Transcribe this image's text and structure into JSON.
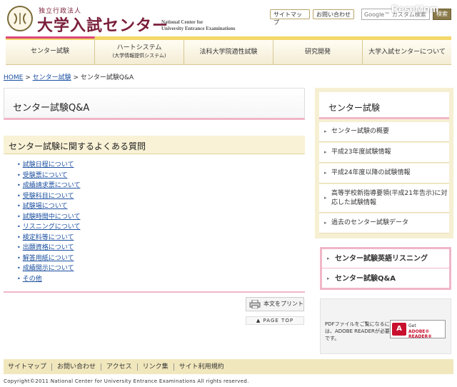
{
  "header": {
    "org_type": "独立行政法人",
    "site_name": "大学入試センター",
    "english_name_line1": "National Center for",
    "english_name_line2": "University Entrance Examinations",
    "util_links": [
      "サイトマップ",
      "お問い合わせ"
    ],
    "search_placeholder": "Google™ カスタム検索",
    "search_button": "検索",
    "watermark": "ReseMom"
  },
  "gnav": {
    "items": [
      {
        "label": "センター試験",
        "sub": ""
      },
      {
        "label": "ハートシステム",
        "sub": "(大学情報提供システム)"
      },
      {
        "label": "法科大学院適性試験",
        "sub": ""
      },
      {
        "label": "研究開発",
        "sub": ""
      },
      {
        "label": "大学入試センターについて",
        "sub": ""
      }
    ]
  },
  "breadcrumb": {
    "home": "HOME",
    "sep": ">",
    "parent": "センター試験",
    "current": "センター試験Q&A"
  },
  "main": {
    "page_title": "センター試験Q&A",
    "section_title": "センター試験に関するよくある質問",
    "qa_links": [
      "試験日程について",
      "受験票について",
      "成績請求票について",
      "受験科目について",
      "試験場について",
      "試験時間中について",
      "リスニングについて",
      "検定料等について",
      "出願資格について",
      "解答用紙について",
      "成績開示について",
      "その他"
    ],
    "print_button": "本文をプリント",
    "page_top": "▲ PAGE TOP"
  },
  "sidebar": {
    "title": "センター試験",
    "items": [
      "センター試験の概要",
      "平成23年度試験情報",
      "平成24年度以降の試験情報",
      "高等学校新指導要領(平成21年告示)に対応した試験情報",
      "過去のセンター試験データ"
    ],
    "featured_links": [
      "センター試験英語リスニング",
      "センター試験Q&A"
    ],
    "pdf_note": "PDFファイルをご覧になるには、ADOBE READERが必要です。",
    "reader_get": "Get",
    "reader_label": "ADOBE® READER®"
  },
  "footer": {
    "links": [
      "サイトマップ",
      "お問い合わせ",
      "アクセス",
      "リンク集",
      "サイト利用規約"
    ],
    "copyright": "Copyright©2011 National Center for University Entrance Examinations All rights reserved."
  },
  "colors": {
    "accent_pink": "#f0b6c8",
    "nav_yellow": "#f3d76a",
    "panel_beige": "#f6efd2",
    "link_blue": "#1a4fa0",
    "brand_maroon": "#7a1f3a"
  }
}
